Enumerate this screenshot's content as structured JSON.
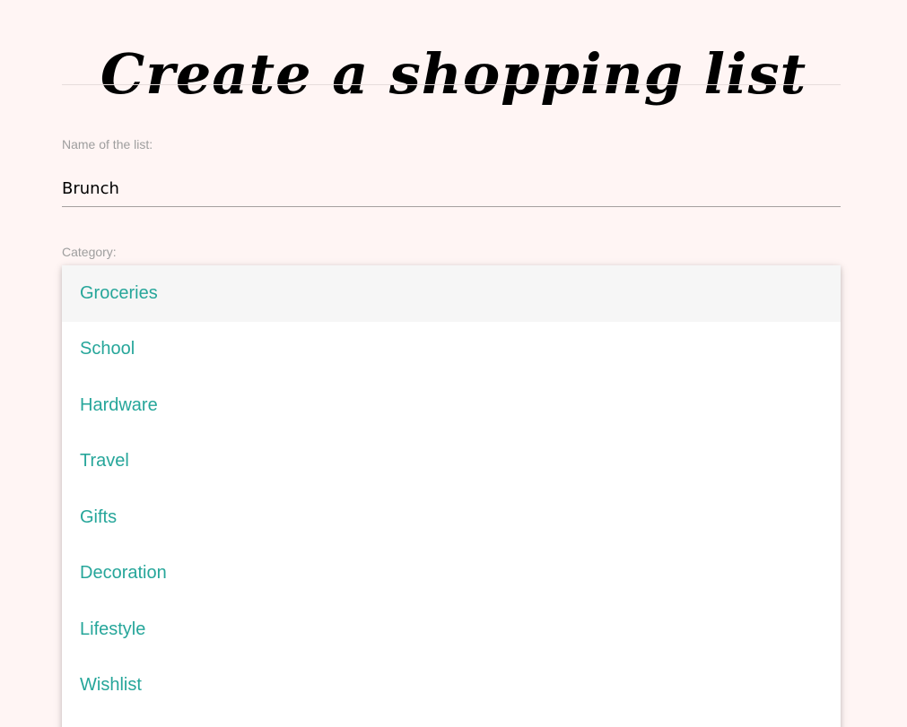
{
  "header": {
    "title": "Create a shopping list"
  },
  "form": {
    "name_label": "Name of the list:",
    "name_value": "Brunch",
    "category_label": "Category:",
    "category_options": [
      "Groceries",
      "School",
      "Hardware",
      "Travel",
      "Gifts",
      "Decoration",
      "Lifestyle",
      "Wishlist"
    ],
    "highlighted_option": "Groceries"
  },
  "colors": {
    "background": "#fff5f4",
    "option_text": "#26a69a",
    "highlight": "#f6f6f6",
    "label": "#9e9e9e"
  }
}
